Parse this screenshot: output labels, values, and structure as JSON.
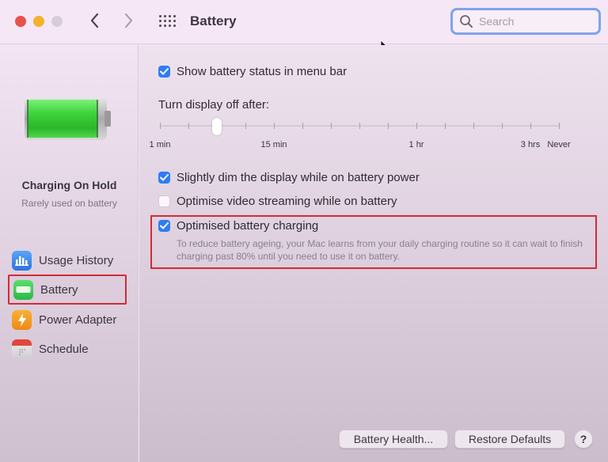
{
  "window": {
    "title": "Battery",
    "search_placeholder": "Search",
    "search_value": ""
  },
  "sidebar": {
    "status_title": "Charging On Hold",
    "status_subtitle": "Rarely used on battery",
    "battery_level_percent": 100,
    "items": [
      {
        "label": "Usage History",
        "icon": "bar-chart-icon",
        "selected": false
      },
      {
        "label": "Battery",
        "icon": "battery-icon",
        "selected": true
      },
      {
        "label": "Power Adapter",
        "icon": "lightning-icon",
        "selected": false
      },
      {
        "label": "Schedule",
        "icon": "calendar-icon",
        "selected": false
      }
    ]
  },
  "main": {
    "show_status": {
      "label": "Show battery status in menu bar",
      "checked": true
    },
    "display_off": {
      "label": "Turn display off after:",
      "tick_count": 15,
      "selected_tick_index": 2,
      "tick_labels": [
        {
          "text": "1 min",
          "tick": 0
        },
        {
          "text": "15 min",
          "tick": 4
        },
        {
          "text": "1 hr",
          "tick": 9
        },
        {
          "text": "3 hrs",
          "tick": 13
        },
        {
          "text": "Never",
          "tick": 14
        }
      ]
    },
    "dim_display": {
      "label": "Slightly dim the display while on battery power",
      "checked": true
    },
    "optimise_video": {
      "label": "Optimise video streaming while on battery",
      "checked": false
    },
    "optimised_charging": {
      "label": "Optimised battery charging",
      "checked": true,
      "description": "To reduce battery ageing, your Mac learns from your daily charging routine so it can wait to finish charging past 80% until you need to use it on battery."
    },
    "buttons": {
      "battery_health": "Battery Health...",
      "restore_defaults": "Restore Defaults",
      "help": "?"
    }
  },
  "colors": {
    "accent": "#2e7cf6",
    "highlight_border": "#d12b36",
    "battery_green": "#34d13a"
  }
}
